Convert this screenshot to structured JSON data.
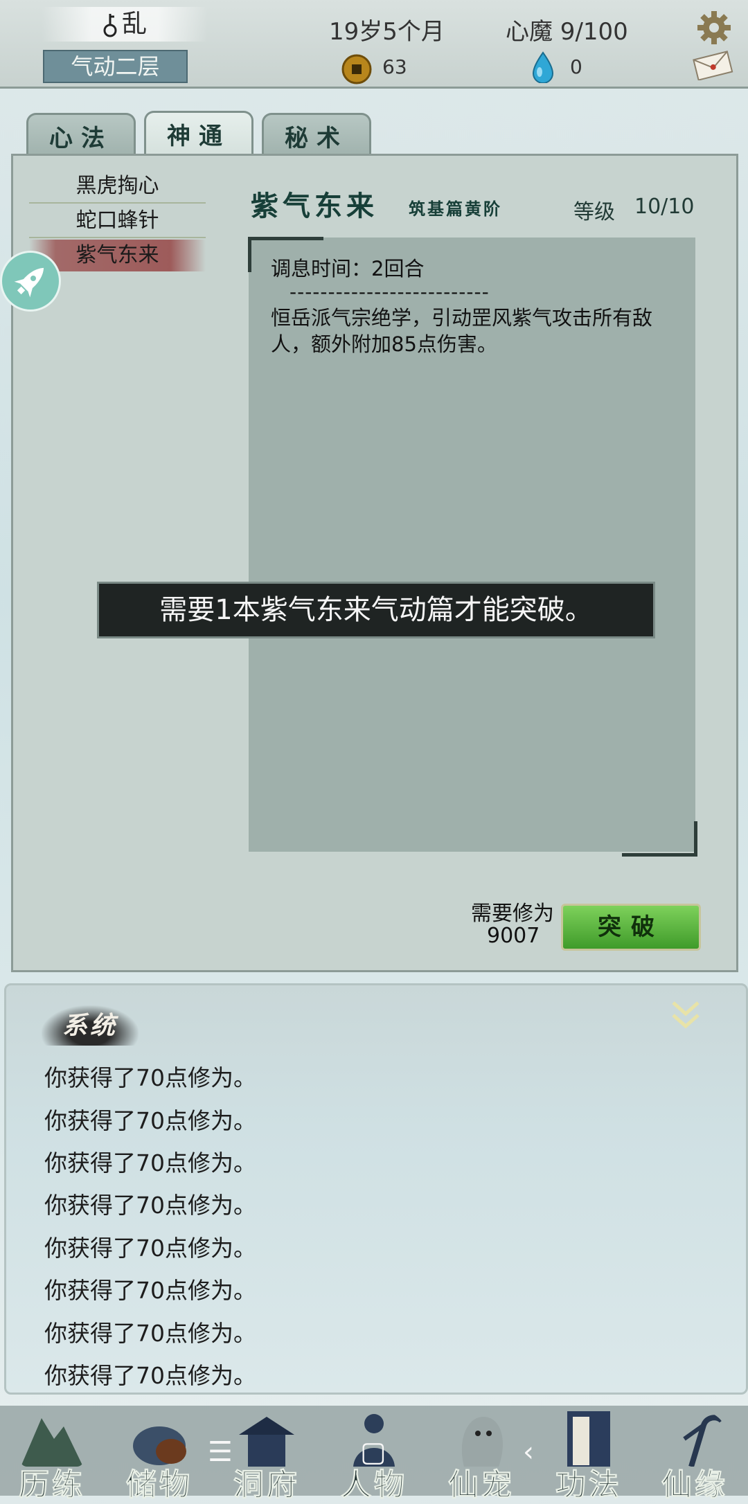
{
  "status": {
    "name": "乱",
    "realm": "气动二层",
    "age": "19岁5个月",
    "xinmo": "心魔  9/100",
    "coins": "63",
    "spirit_drops": "0"
  },
  "tabs": [
    {
      "label": "心法",
      "active": false
    },
    {
      "label": "神通",
      "active": true
    },
    {
      "label": "秘术",
      "active": false
    }
  ],
  "skills": [
    {
      "label": "黑虎掏心",
      "selected": false
    },
    {
      "label": "蛇口蜂针",
      "selected": false
    },
    {
      "label": "紫气东来",
      "selected": true
    }
  ],
  "detail": {
    "title": "紫气东来",
    "subtitle": "筑基篇黄阶",
    "level_label": "等级",
    "level_value": "10/10",
    "rest_time": "调息时间：2回合",
    "divider": "--------------------------",
    "description": "恒岳派气宗绝学，引动罡风紫气攻击所有敌人，额外附加85点伤害。"
  },
  "toast": "需要1本紫气东来气动篇才能突破。",
  "breakthrough": {
    "need_label": "需要修为",
    "need_value": "9007",
    "button_label": "突破"
  },
  "log": {
    "title": "系统",
    "lines": [
      "你获得了70点修为。",
      "你获得了70点修为。",
      "你获得了70点修为。",
      "你获得了70点修为。",
      "你获得了70点修为。",
      "你获得了70点修为。",
      "你获得了70点修为。",
      "你获得了70点修为。"
    ]
  },
  "nav": [
    {
      "label": "历练",
      "icon": "mountain-icon"
    },
    {
      "label": "储物",
      "icon": "bag-icon"
    },
    {
      "label": "洞府",
      "icon": "palace-icon"
    },
    {
      "label": "人物",
      "icon": "person-icon"
    },
    {
      "label": "仙宠",
      "icon": "pet-icon"
    },
    {
      "label": "功法",
      "icon": "scroll-icon"
    },
    {
      "label": "仙缘",
      "icon": "crane-icon"
    }
  ],
  "system_nav": {
    "menu": "☰",
    "home": "▢",
    "back": "‹"
  },
  "colors": {
    "accent_green": "#4fae36",
    "panel": "#c7d3cf",
    "selected_item": "#9a4a4a"
  }
}
